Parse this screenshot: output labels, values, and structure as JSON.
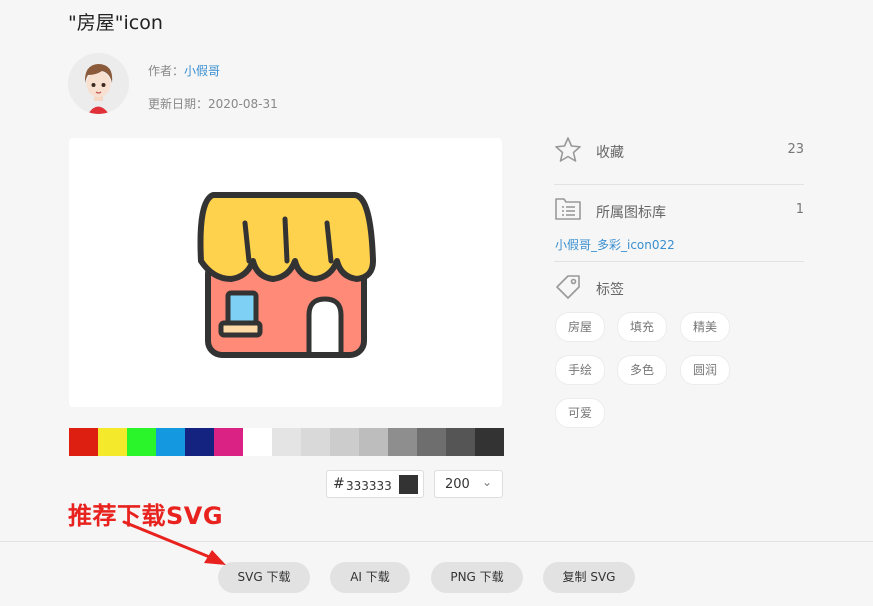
{
  "page": {
    "title": "\"房屋\"icon",
    "author_label": "作者：",
    "author_name": "小假哥",
    "date_label": "更新日期：",
    "date_value": "2020-08-31"
  },
  "swatches": [
    "#dc1f10",
    "#f5e92b",
    "#29f52a",
    "#1499e0",
    "#142380",
    "#d92283",
    "#ffffff",
    "#e4e4e4",
    "#d9d9d9",
    "#cccccc",
    "#bdbdbd",
    "#8e8e8e",
    "#6e6e6e",
    "#555555",
    "#333333"
  ],
  "color_picker": {
    "hash": "#",
    "hex_value": "333333",
    "size_value": "200",
    "size_chevron": "⌄"
  },
  "sidebar": {
    "favorite_label": "收藏",
    "favorite_count": "23",
    "library_label": "所属图标库",
    "library_count": "1",
    "library_name": "小假哥_多彩_icon022",
    "tags_label": "标签",
    "tags": [
      "房屋",
      "填充",
      "精美",
      "手绘",
      "多色",
      "圆润",
      "可爱"
    ]
  },
  "downloads": {
    "svg_label": "SVG 下载",
    "ai_label": "AI 下载",
    "png_label": "PNG 下载",
    "copy_label": "复制 SVG"
  },
  "annotation": {
    "text": "推荐下载SVG"
  },
  "colors": {
    "accent_link": "#3a8fd0",
    "annotation_red": "#e8231f",
    "awning_yellow": "#ffd24d",
    "house_salmon": "#ff8a78",
    "window_blue": "#7fd0f5",
    "outline": "#333333"
  }
}
